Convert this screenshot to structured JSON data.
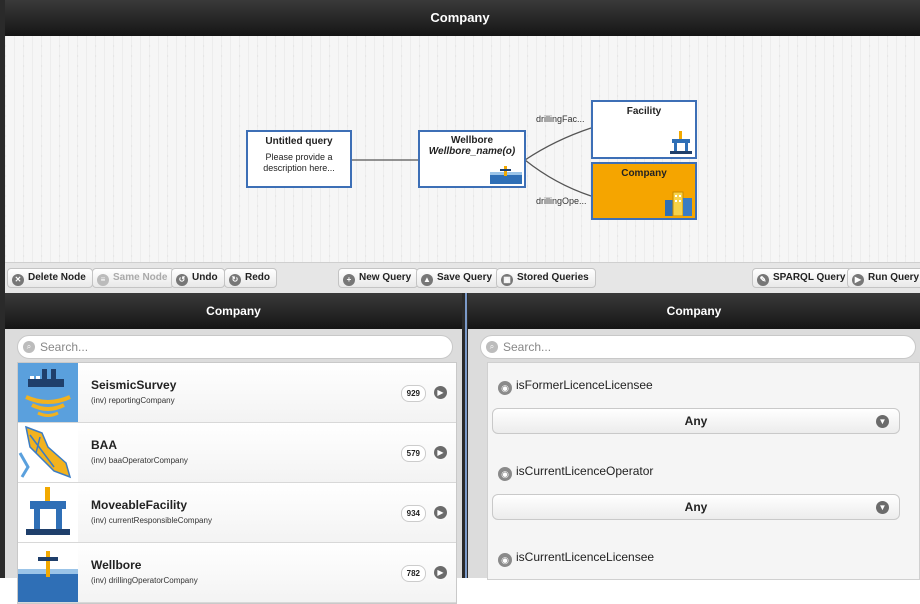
{
  "window": {
    "title": "Company"
  },
  "graph": {
    "nodes": {
      "query": {
        "title": "Untitled query",
        "description": "Please provide a description here..."
      },
      "wellbore": {
        "title": "Wellbore",
        "subtitle": "Wellbore_name(o)"
      },
      "facility": {
        "title": "Facility"
      },
      "company": {
        "title": "Company"
      }
    },
    "edges": {
      "facility_edge": "drillingFac...",
      "company_edge": "drillingOpe..."
    },
    "colors": {
      "node_border": "#3d6fb6",
      "selected_fill": "#f5a500"
    }
  },
  "toolbar": {
    "delete_node": "Delete Node",
    "same_node": "Same Node",
    "undo": "Undo",
    "redo": "Redo",
    "new_query": "New Query",
    "save_query": "Save Query",
    "stored_queries": "Stored Queries",
    "sparql_query": "SPARQL Query",
    "run_query": "Run Query"
  },
  "left_panel": {
    "title": "Company",
    "search_placeholder": "Search...",
    "items": [
      {
        "name": "SeismicSurvey",
        "relation": "(inv) reportingCompany",
        "count": "929",
        "icon": "seismic-ship-icon"
      },
      {
        "name": "BAA",
        "relation": "(inv) baaOperatorCompany",
        "count": "579",
        "icon": "baa-area-icon"
      },
      {
        "name": "MoveableFacility",
        "relation": "(inv) currentResponsibleCompany",
        "count": "934",
        "icon": "oil-rig-icon"
      },
      {
        "name": "Wellbore",
        "relation": "(inv) drillingOperatorCompany",
        "count": "782",
        "icon": "wellbore-icon"
      }
    ]
  },
  "right_panel": {
    "title": "Company",
    "search_placeholder": "Search...",
    "properties": [
      {
        "name": "isFormerLicenceLicensee",
        "value": "Any"
      },
      {
        "name": "isCurrentLicenceOperator",
        "value": "Any"
      },
      {
        "name": "isCurrentLicenceLicensee"
      }
    ]
  }
}
